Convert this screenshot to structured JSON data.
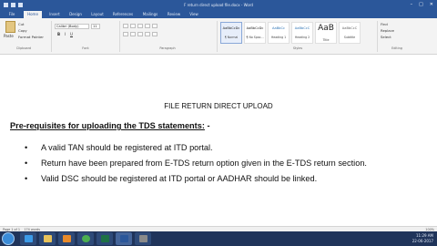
{
  "window": {
    "title": "F return direct upload file.docx - Word",
    "minimize_glyph": "–",
    "maximize_glyph": "□",
    "close_glyph": "✕"
  },
  "tabs": [
    "File",
    "Home",
    "Insert",
    "Design",
    "Layout",
    "References",
    "Mailings",
    "Review",
    "View"
  ],
  "ribbon": {
    "clipboard": {
      "paste": "Paste",
      "cut": "Cut",
      "copy": "Copy",
      "format_painter": "Format Painter",
      "label": "Clipboard"
    },
    "font": {
      "name": "Calibri (Body)",
      "size": "11",
      "label": "Font",
      "bold": "B",
      "italic": "I",
      "underline": "U"
    },
    "paragraph": {
      "label": "Paragraph"
    },
    "styles": {
      "label": "Styles",
      "items": [
        {
          "preview": "AaBbCcDc",
          "name": "¶ Normal"
        },
        {
          "preview": "AaBbCcDc",
          "name": "¶ No Spac..."
        },
        {
          "preview": "AaBbCc",
          "name": "Heading 1"
        },
        {
          "preview": "AaBbCcC",
          "name": "Heading 2"
        },
        {
          "preview": "AaB",
          "name": "Title"
        },
        {
          "preview": "AaBbCcC",
          "name": "Subtitle"
        }
      ]
    },
    "editing": {
      "find": "Find",
      "replace": "Replace",
      "select": "Select",
      "label": "Editing"
    }
  },
  "document": {
    "title": "FILE RETURN DIRECT UPLOAD",
    "prereq_underlined": "Pre-requisites for uploading the TDS statements:",
    "prereq_suffix": " -",
    "bullets": [
      "A valid TAN should be registered at ITD portal.",
      "Return have been prepared from E-TDS return option given in the E-TDS return section.",
      "Valid DSC should be registered at ITD portal or AADHAR should be linked."
    ]
  },
  "status": {
    "page": "Page 1 of 1",
    "words": "174 words",
    "zoom": "100%"
  },
  "taskbar": {
    "time": "11:29 AM",
    "date": "22-06-2017"
  },
  "colors": {
    "accent": "#2b579a",
    "taskbar": "#20345a"
  }
}
